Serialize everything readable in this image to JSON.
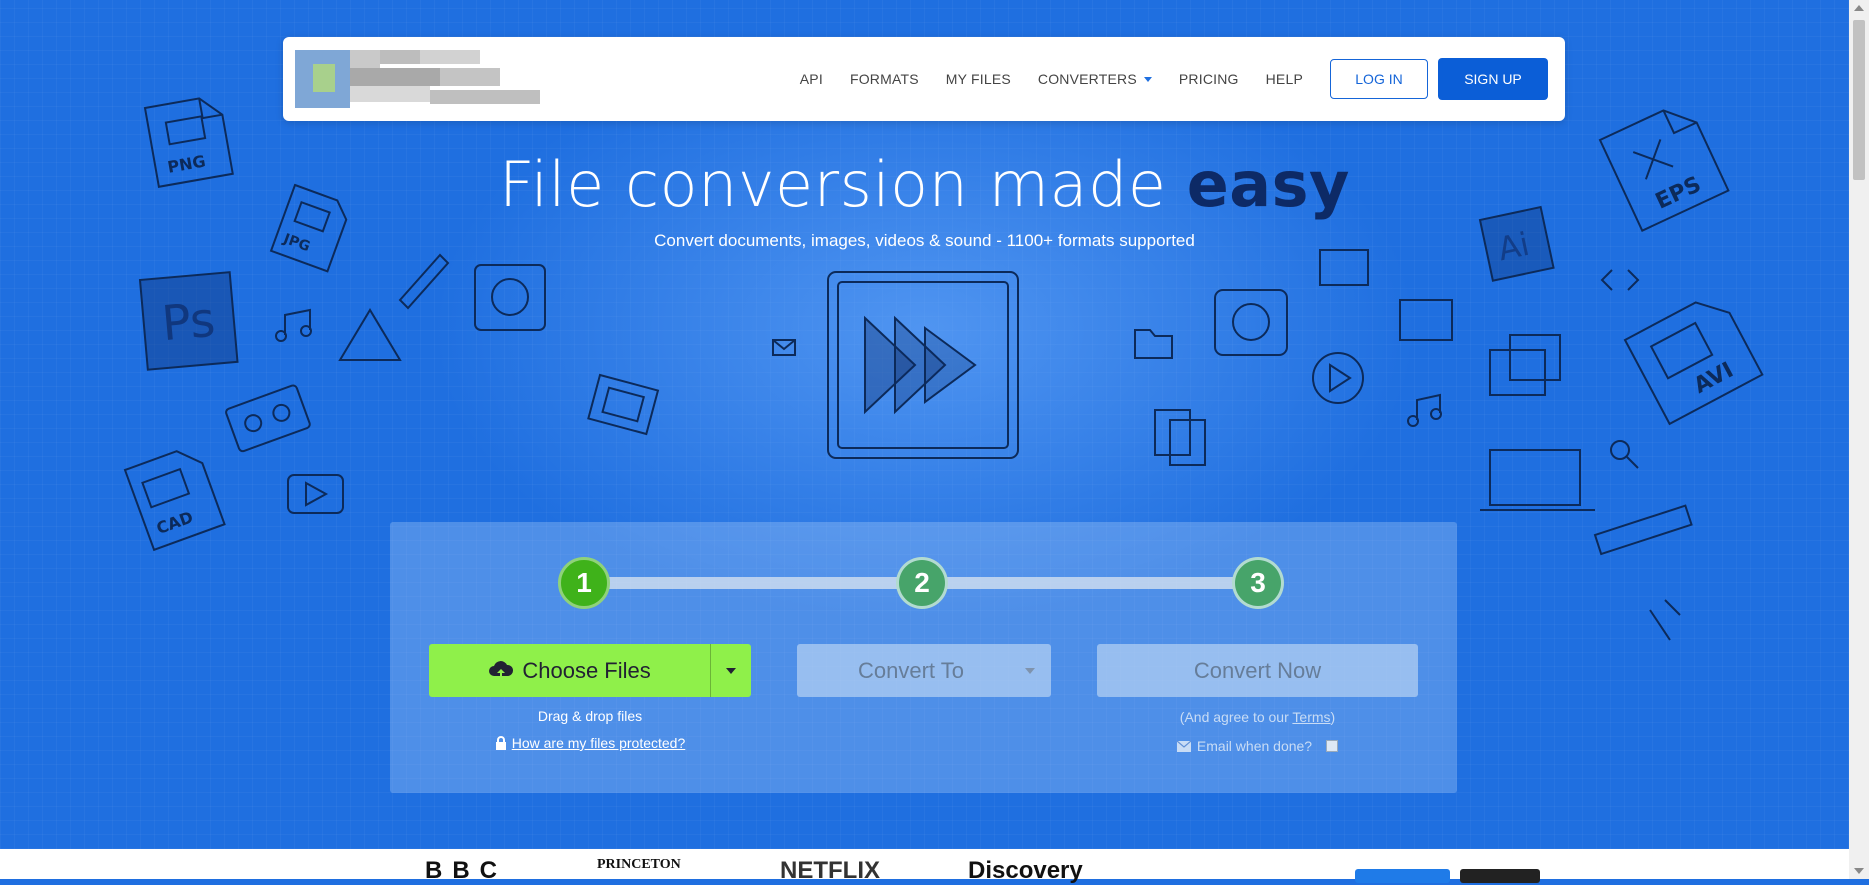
{
  "nav": {
    "links": [
      {
        "label": "API"
      },
      {
        "label": "FORMATS"
      },
      {
        "label": "MY FILES"
      },
      {
        "label": "CONVERTERS"
      },
      {
        "label": "PRICING"
      },
      {
        "label": "HELP"
      }
    ],
    "login": "LOG IN",
    "signup": "SIGN UP"
  },
  "hero": {
    "title_main": "File conversion made",
    "title_strong": "easy",
    "subtitle": "Convert documents, images, videos & sound - 1100+ formats supported"
  },
  "steps": [
    "1",
    "2",
    "3"
  ],
  "converter": {
    "choose_files": "Choose Files",
    "convert_to": "Convert To",
    "convert_now": "Convert Now",
    "drag_drop": "Drag & drop files",
    "protected_link": "How are my files protected?",
    "agree_prefix": "(And agree to our",
    "terms": "Terms",
    "agree_suffix": ")",
    "email_label": "Email when done?"
  },
  "doodle_labels": [
    "PNG",
    "JPG",
    "Ps",
    "CAD",
    "EPS",
    "Ai",
    "AVI"
  ],
  "bottom_logos": [
    "BBC",
    "PRINCETON",
    "NETFLIX",
    "Discovery"
  ],
  "colors": {
    "background": "#1f6fe0",
    "signup": "#0b5ed7",
    "choose_files": "#8ff04a",
    "step_active": "#3fb21a",
    "title_strong": "#0d2a66"
  }
}
